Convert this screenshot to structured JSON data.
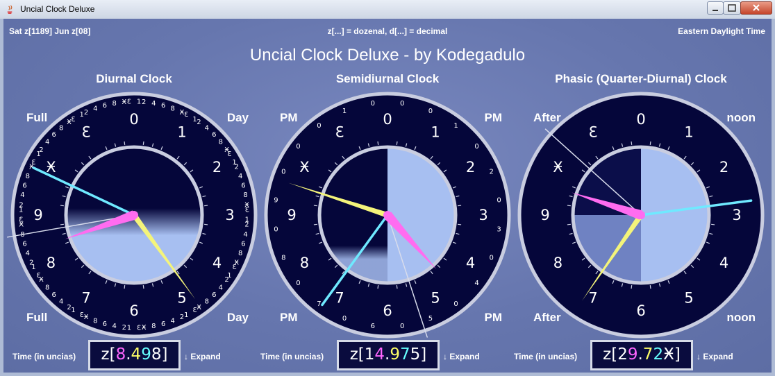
{
  "window": {
    "title": "Uncial Clock Deluxe"
  },
  "header": {
    "date": "Sat z[1189] Jun z[08]",
    "legend": "z[...] = dozenal, d[...] = decimal",
    "timezone": "Eastern Daylight Time"
  },
  "main_title": "Uncial Clock Deluxe - by Kodegadulo",
  "digits": [
    "0",
    "1",
    "2",
    "3",
    "4",
    "5",
    "6",
    "7",
    "8",
    "9",
    "Ӿ",
    "Ɛ"
  ],
  "clocks": [
    {
      "title": "Diurnal Clock",
      "captions": {
        "top_left": "Full",
        "top_right": "Day",
        "bottom_left": "Full",
        "bottom_right": "Day"
      },
      "inner_ring": "dozenal",
      "hands": {
        "yellow_units": 4.8,
        "magenta_units": 8.36,
        "cyan_units": 9.84,
        "white_units": 8.67
      },
      "face_fill": "diurnal-lower-half",
      "time_label": "Time (in uncias)",
      "time_prefix": "z[",
      "time_digits": [
        {
          "text": "8",
          "color": "#ff66ff"
        },
        {
          "text": ".",
          "color": "#ffffff"
        },
        {
          "text": "4",
          "color": "#ffff66"
        },
        {
          "text": "9",
          "color": "#66ffff"
        },
        {
          "text": "8",
          "color": "#ffffff"
        }
      ],
      "time_suffix": "]",
      "expand": "↓ Expand"
    },
    {
      "title": "Semidiurnal Clock",
      "captions": {
        "top_left": "PM",
        "top_right": "PM",
        "bottom_left": "PM",
        "bottom_right": "PM"
      },
      "inner_ring": "decimal",
      "hands": {
        "yellow_units": 9.6,
        "magenta_units": 4.6,
        "cyan_units": 7.2,
        "white_units": 5.4
      },
      "face_fill": "semi-right-half",
      "time_label": "Time (in uncias)",
      "time_prefix": "z[",
      "time_digits": [
        {
          "text": "1",
          "color": "#ffffff"
        },
        {
          "text": "4",
          "color": "#ff66ff"
        },
        {
          "text": ".",
          "color": "#ffffff"
        },
        {
          "text": "9",
          "color": "#ffff66"
        },
        {
          "text": "7",
          "color": "#66ffff"
        },
        {
          "text": "5",
          "color": "#ffffff"
        }
      ],
      "time_suffix": "]",
      "expand": "↓ Expand"
    },
    {
      "title": "Phasic (Quarter-Diurnal) Clock",
      "captions": {
        "top_left": "After",
        "top_right": "noon",
        "bottom_left": "After",
        "bottom_right": "noon"
      },
      "inner_ring": "none",
      "hands": {
        "yellow_units": 7.15,
        "magenta_units": 9.6,
        "cyan_units": 2.75,
        "white_units": 10.4
      },
      "face_fill": "phasic-quarter",
      "time_label": "Time (in uncias)",
      "time_prefix": "z[",
      "time_digits": [
        {
          "text": "2",
          "color": "#ffffff"
        },
        {
          "text": "9",
          "color": "#ff66ff"
        },
        {
          "text": ".",
          "color": "#ffffff"
        },
        {
          "text": "7",
          "color": "#ffff66"
        },
        {
          "text": "2",
          "color": "#66ffff"
        },
        {
          "text": "Ӿ",
          "color": "#ffffff"
        }
      ],
      "time_suffix": "]",
      "expand": "↓ Expand"
    }
  ],
  "colors": {
    "face": "#05063a",
    "ring": "#c9cde0",
    "yellow_hand": "#f4f47a",
    "magenta_hand": "#ff6cf0",
    "cyan_hand": "#6fe9ff",
    "white_hand": "#d8dcec",
    "light_fill": "#a7bff1"
  }
}
